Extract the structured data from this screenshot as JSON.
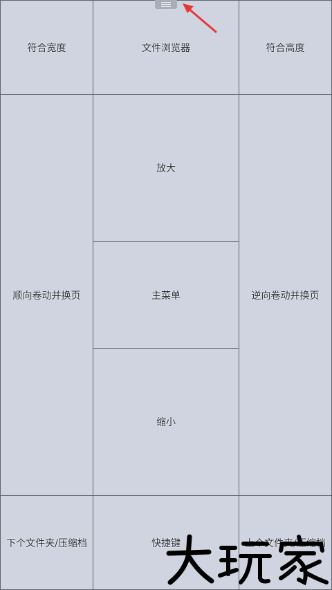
{
  "zones": {
    "fit_width": "符合宽度",
    "file_browser": "文件浏览器",
    "fit_height": "符合高度",
    "scroll_forward": "顺向卷动并换页",
    "zoom_in": "放大",
    "main_menu": "主菜单",
    "zoom_out": "缩小",
    "scroll_backward": "逆向卷动并换页",
    "next_folder": "下个文件夹/压缩档",
    "shortcut": "快捷键",
    "prev_folder": "上个文件夹/压缩档"
  },
  "watermark": {
    "text": "大玩家"
  },
  "colors": {
    "background": "#cfd4e0",
    "divider": "#5f646e",
    "arrow": "#e53935",
    "handle": "#a9adb6"
  },
  "icons": {
    "handle": "menu-handle-icon",
    "arrow": "annotation-arrow-icon"
  }
}
